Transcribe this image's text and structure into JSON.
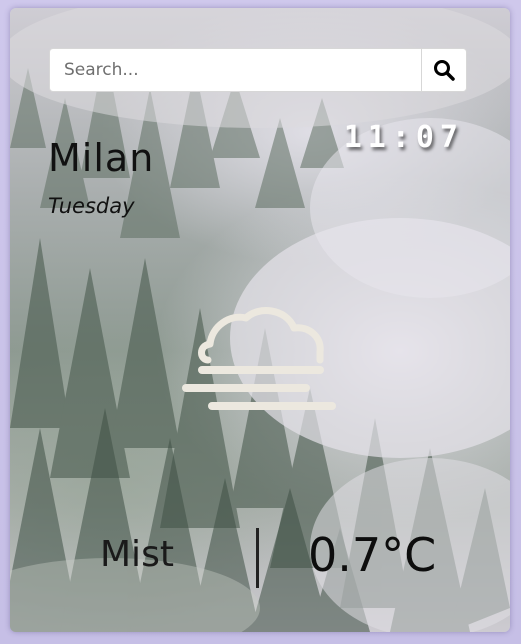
{
  "search": {
    "placeholder": "Search...",
    "icon": "search-icon"
  },
  "time": "11:07",
  "location": {
    "city": "Milan",
    "day": "Tuesday"
  },
  "weather": {
    "icon": "mist-icon",
    "condition": "Mist",
    "temperature": "0.7°C"
  },
  "colors": {
    "page_background": "#c9c2e6",
    "icon_color": "#ece8df",
    "text": "#111111"
  }
}
